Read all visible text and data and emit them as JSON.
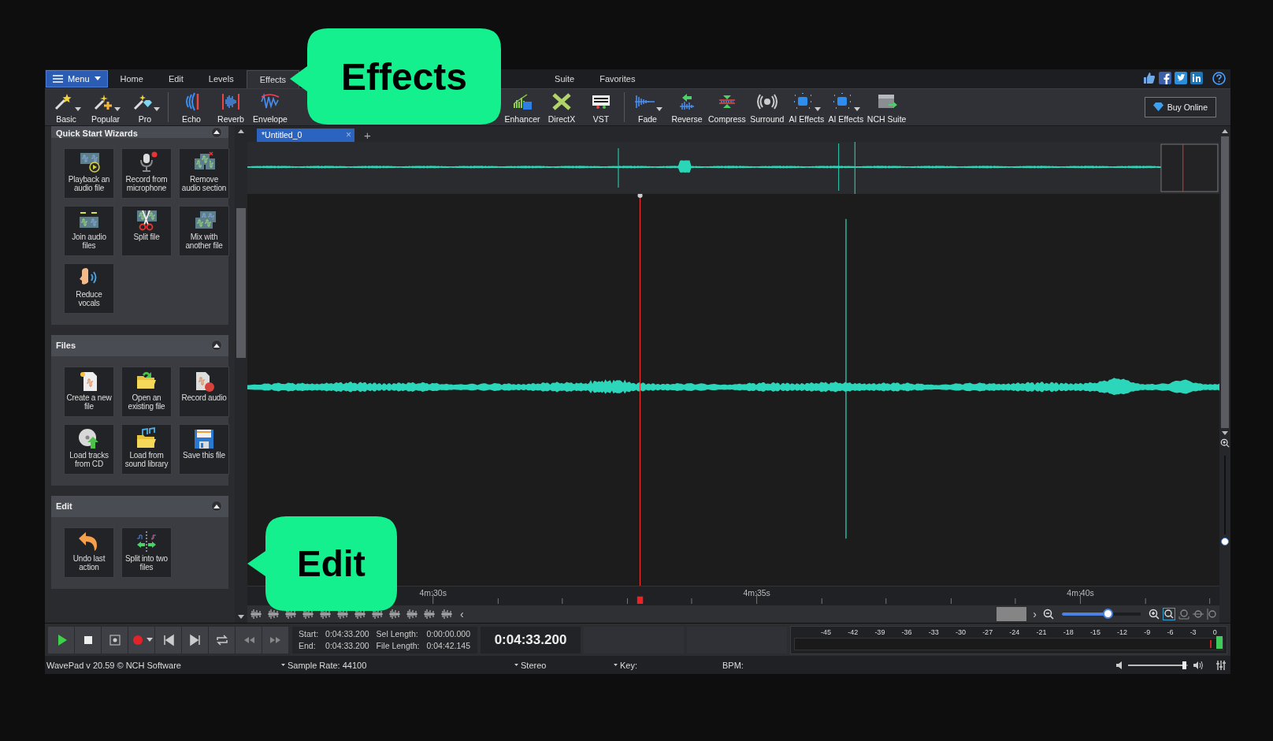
{
  "menu_button": {
    "label": "Menu"
  },
  "tabs": [
    {
      "label": "Home",
      "selected": false
    },
    {
      "label": "Edit",
      "selected": false
    },
    {
      "label": "Levels",
      "selected": false
    },
    {
      "label": "Effects",
      "selected": true
    },
    {
      "label": "Suite",
      "selected": false
    },
    {
      "label": "Favorites",
      "selected": false
    }
  ],
  "toolbar": {
    "groups": [
      [
        {
          "label": "Basic",
          "dropdown": true
        },
        {
          "label": "Popular",
          "dropdown": true
        },
        {
          "label": "Pro",
          "dropdown": true
        }
      ],
      [
        {
          "label": "Echo",
          "dropdown": false
        },
        {
          "label": "Reverb",
          "dropdown": false
        },
        {
          "label": "Envelope",
          "dropdown": false
        },
        {
          "label": "Enhancer",
          "dropdown": false
        },
        {
          "label": "DirectX",
          "dropdown": false
        },
        {
          "label": "VST",
          "dropdown": false
        }
      ],
      [
        {
          "label": "Fade",
          "dropdown": true
        },
        {
          "label": "Reverse",
          "dropdown": false
        },
        {
          "label": "Compress",
          "dropdown": false
        },
        {
          "label": "Surround",
          "dropdown": false
        },
        {
          "label": "AI Effects",
          "dropdown": true
        },
        {
          "label": "AI Effects",
          "dropdown": true
        },
        {
          "label": "NCH Suite",
          "dropdown": false
        }
      ]
    ],
    "buy_button": "Buy Online"
  },
  "panel": {
    "sections": [
      {
        "title": "Quick Start Wizards",
        "expanded": true,
        "tiles": [
          "Playback an audio file",
          "Record from microphone",
          "Remove audio section",
          "Join audio files",
          "Split file",
          "Mix with another file",
          "Reduce vocals"
        ]
      },
      {
        "title": "Files",
        "expanded": true,
        "tiles": [
          "Create a new file",
          "Open an existing file",
          "Record audio",
          "Load tracks from CD",
          "Load from sound library",
          "Save this file"
        ]
      },
      {
        "title": "Edit",
        "expanded": true,
        "tiles": [
          "Undo last action",
          "Split into two files"
        ]
      }
    ]
  },
  "document_tab": {
    "title": "*Untitled_0",
    "close": "×",
    "new_tab": "+"
  },
  "ruler": [
    "4m:30s",
    "4m:35s",
    "4m:40s"
  ],
  "zoom": {
    "prev": "‹",
    "next": "›",
    "level": 0.58
  },
  "transport": {
    "fields": [
      {
        "label": "Start:",
        "value": "0:04:33.200"
      },
      {
        "label": "End:",
        "value": "0:04:33.200"
      },
      {
        "label": "Sel Length:",
        "value": "0:00:00.000"
      },
      {
        "label": "File Length:",
        "value": "0:04:42.145"
      }
    ],
    "time": "0:04:33.200"
  },
  "meter": {
    "scale": [
      "-45",
      "-42",
      "-39",
      "-36",
      "-33",
      "-30",
      "-27",
      "-24",
      "-21",
      "-18",
      "-15",
      "-12",
      "-9",
      "-6",
      "-3",
      "0"
    ]
  },
  "status": {
    "version": "WavePad v 20.59 © NCH Software",
    "items": [
      "Sample Rate: 44100",
      "Stereo",
      "Key:"
    ],
    "bpm": "BPM:",
    "volume": {
      "level": 0.95
    }
  },
  "callouts": [
    {
      "text": "Effects"
    },
    {
      "text": "Edit"
    }
  ]
}
